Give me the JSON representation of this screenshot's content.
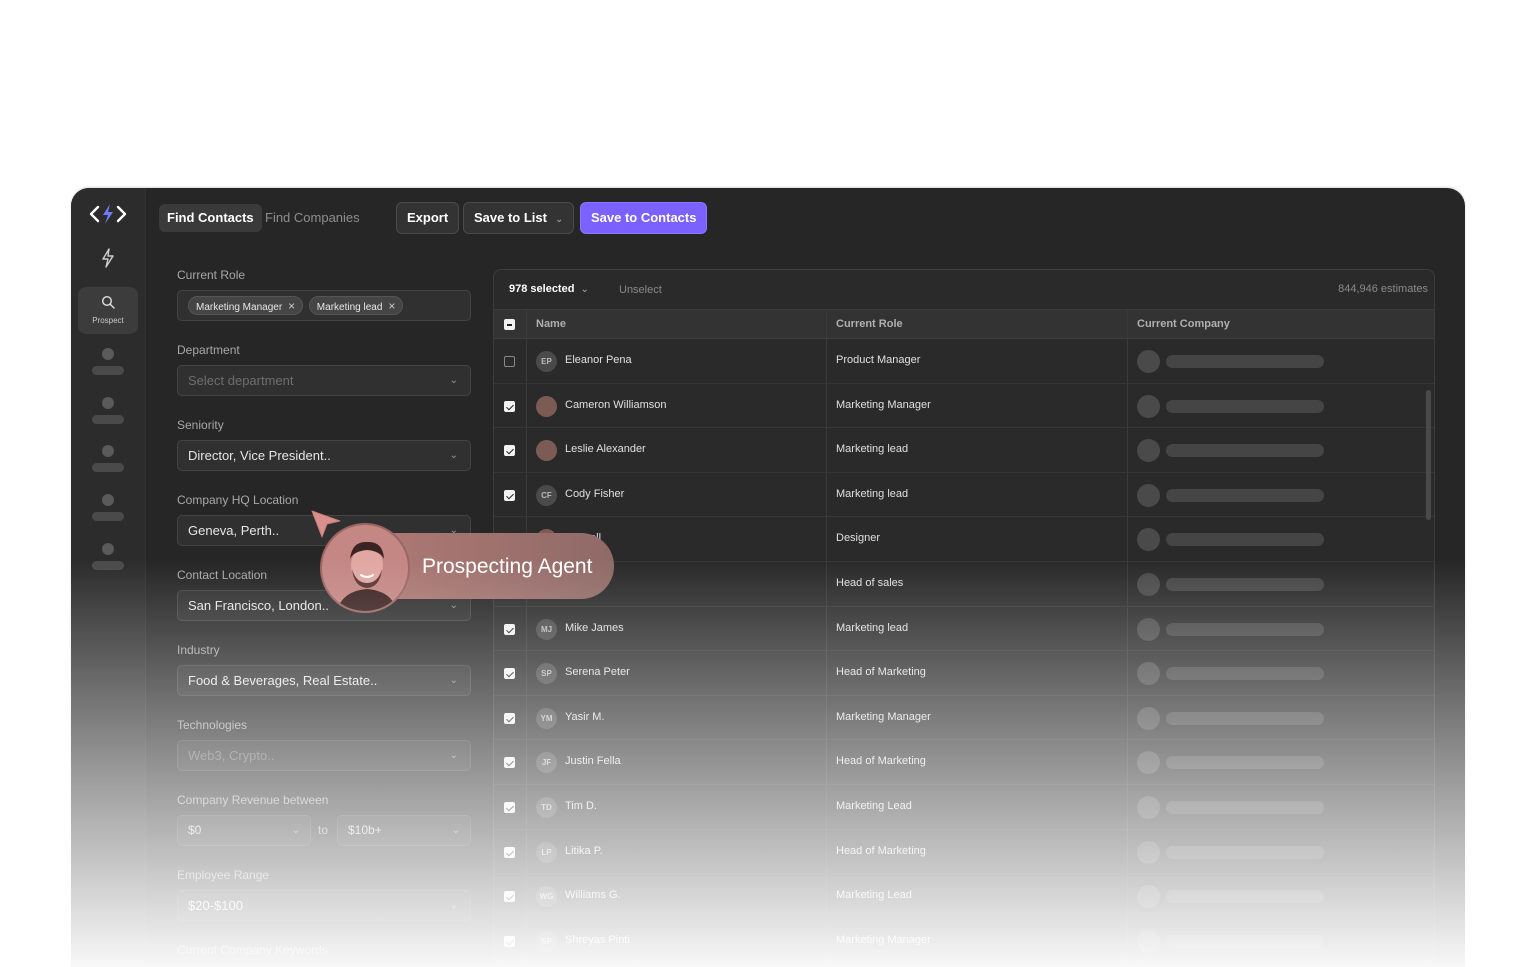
{
  "tabs": {
    "find_contacts": "Find Contacts",
    "find_companies": "Find Companies"
  },
  "toolbar": {
    "export": "Export",
    "save_to_list": "Save to List",
    "save_to_contacts": "Save to Contacts"
  },
  "rail": {
    "prospect_label": "Prospect"
  },
  "filters": {
    "current_role": {
      "label": "Current Role",
      "chips": [
        "Marketing Manager",
        "Marketing lead"
      ]
    },
    "department": {
      "label": "Department",
      "placeholder": "Select department"
    },
    "seniority": {
      "label": "Seniority",
      "value": "Director, Vice President.."
    },
    "hq_location": {
      "label": "Company HQ Location",
      "value": "Geneva, Perth.."
    },
    "contact_location": {
      "label": "Contact Location",
      "value": "San Francisco, London.."
    },
    "industry": {
      "label": "Industry",
      "value": "Food & Beverages, Real Estate.."
    },
    "technologies": {
      "label": "Technologies",
      "placeholder": "Web3, Crypto.."
    },
    "revenue": {
      "label": "Company Revenue between",
      "min": "$0",
      "to": "to",
      "max": "$10b+"
    },
    "employee_range": {
      "label": "Employee Range",
      "value": "$20-$100"
    },
    "extra": {
      "label": "Current Company Keywords"
    }
  },
  "table": {
    "selected": "978 selected",
    "unselect": "Unselect",
    "estimates": "844,946 estimates",
    "columns": {
      "name": "Name",
      "role": "Current Role",
      "company": "Current Company"
    },
    "rows": [
      {
        "initials": "EP",
        "name": "Eleanor Pena",
        "role": "Product Manager",
        "checked": false,
        "photo": false
      },
      {
        "initials": "",
        "name": "Cameron Williamson",
        "role": "Marketing Manager",
        "checked": true,
        "photo": true
      },
      {
        "initials": "",
        "name": "Leslie Alexander",
        "role": "Marketing lead",
        "checked": true,
        "photo": true
      },
      {
        "initials": "CF",
        "name": "Cody Fisher",
        "role": "Marketing lead",
        "checked": true,
        "photo": false
      },
      {
        "initials": "",
        "name": "Russell",
        "role": "Designer",
        "checked": true,
        "photo": true
      },
      {
        "initials": "",
        "name": "",
        "role": "Head of sales",
        "checked": true,
        "photo": false
      },
      {
        "initials": "MJ",
        "name": "Mike James",
        "role": "Marketing lead",
        "checked": true,
        "photo": false
      },
      {
        "initials": "SP",
        "name": "Serena Peter",
        "role": "Head of Marketing",
        "checked": true,
        "photo": false
      },
      {
        "initials": "YM",
        "name": "Yasir M.",
        "role": "Marketing Manager",
        "checked": true,
        "photo": false
      },
      {
        "initials": "JF",
        "name": "Justin Fella",
        "role": "Head of Marketing",
        "checked": true,
        "photo": false
      },
      {
        "initials": "TD",
        "name": "Tim D.",
        "role": "Marketing Lead",
        "checked": true,
        "photo": false
      },
      {
        "initials": "LP",
        "name": "Litika P.",
        "role": "Head of Marketing",
        "checked": true,
        "photo": false
      },
      {
        "initials": "WG",
        "name": "Williams G.",
        "role": "Marketing Lead",
        "checked": true,
        "photo": false
      },
      {
        "initials": "SP",
        "name": "Shreyas Pinti",
        "role": "Marketing Manager",
        "checked": true,
        "photo": false
      }
    ]
  },
  "agent": {
    "label": "Prospecting Agent"
  },
  "colors": {
    "accent": "#7b61ff",
    "bolt": "#6f7cff",
    "agent_pill": "#b07a75"
  }
}
